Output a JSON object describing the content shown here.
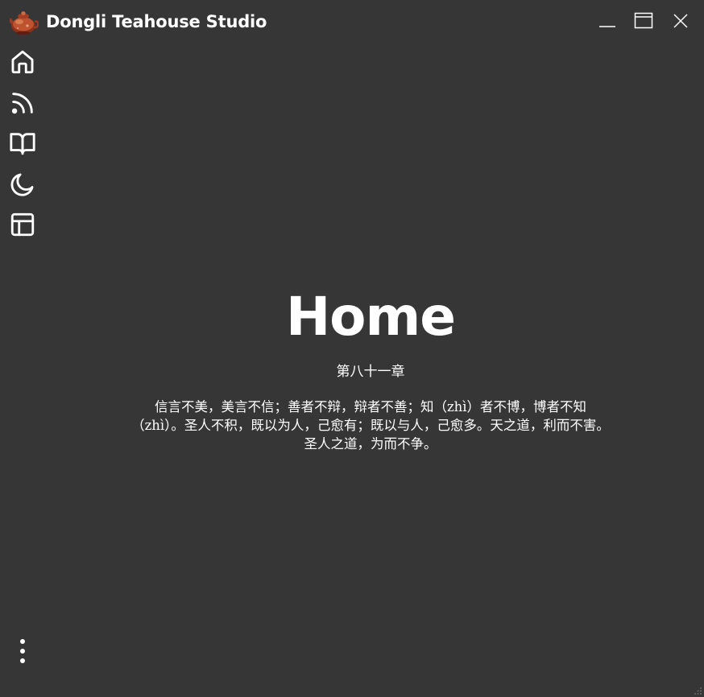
{
  "app": {
    "title": "Dongli Teahouse Studio",
    "logo_icon": "teapot-logo-icon"
  },
  "window_controls": {
    "minimize_icon": "minimize-icon",
    "maximize_icon": "maximize-icon",
    "close_icon": "close-icon"
  },
  "sidebar": {
    "items": [
      {
        "icon": "home-icon"
      },
      {
        "icon": "rss-icon"
      },
      {
        "icon": "book-open-icon"
      },
      {
        "icon": "moon-icon"
      },
      {
        "icon": "layout-icon"
      }
    ],
    "more_icon": "more-vertical-icon"
  },
  "main": {
    "title": "Home",
    "chapter_title": "第八十一章",
    "chapter_text": "信言不美，美言不信；善者不辩，辩者不善；知（zhì）者不博，博者不知（zhì）。圣人不积，既以为人，己愈有；既以与人，己愈多。天之道，利而不害。圣人之道，为而不争。"
  },
  "colors": {
    "background": "#363636",
    "foreground": "#ffffff",
    "logo_primary": "#b5462a"
  }
}
